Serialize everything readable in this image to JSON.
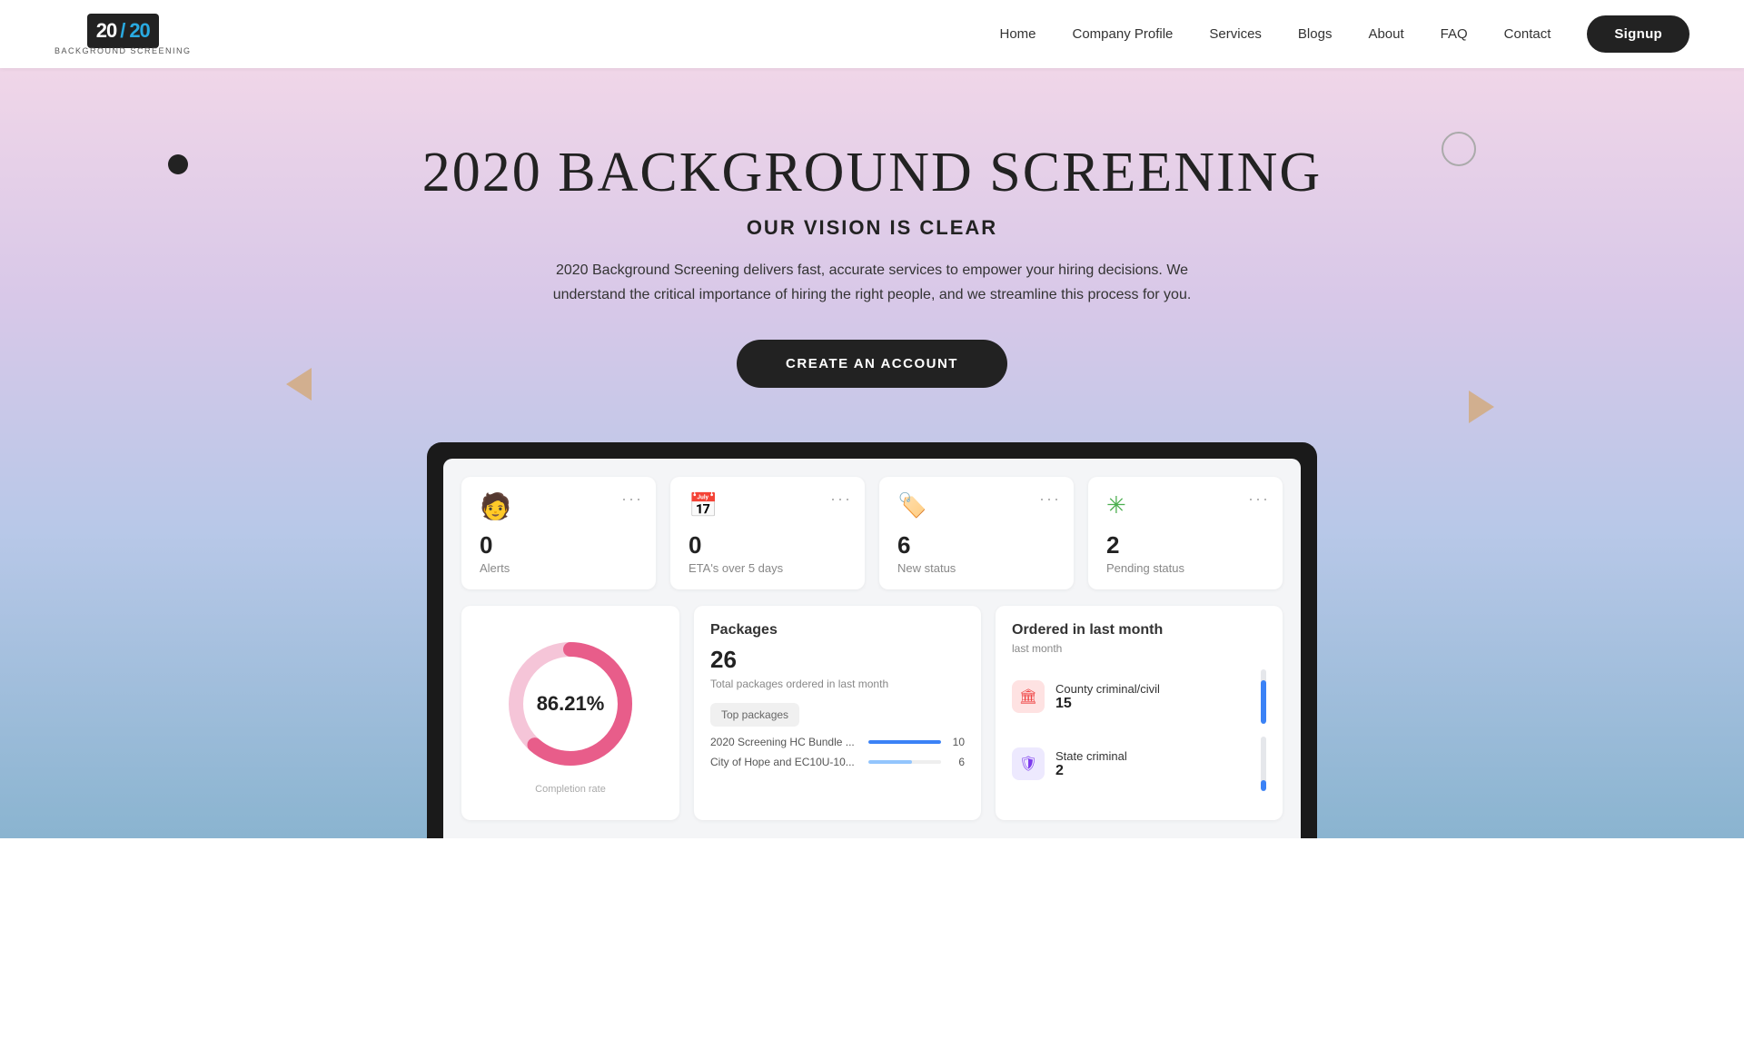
{
  "nav": {
    "logo_text_left": "20",
    "logo_slash": "/",
    "logo_text_right": "20",
    "logo_sub": "BACKGROUND SCREENING",
    "links": [
      {
        "label": "Home",
        "key": "home"
      },
      {
        "label": "Company Profile",
        "key": "company-profile"
      },
      {
        "label": "Services",
        "key": "services"
      },
      {
        "label": "Blogs",
        "key": "blogs"
      },
      {
        "label": "About",
        "key": "about"
      },
      {
        "label": "FAQ",
        "key": "faq"
      },
      {
        "label": "Contact",
        "key": "contact"
      }
    ],
    "signup_label": "Signup"
  },
  "hero": {
    "title": "2020 BACKGROUND SCREENING",
    "subtitle": "OUR VISION IS CLEAR",
    "description": "2020 Background Screening delivers fast, accurate services to empower your hiring decisions. We understand the critical importance of hiring the right people, and we streamline this process for you.",
    "cta_label": "CREATE AN ACCOUNT"
  },
  "dashboard": {
    "stat_cards": [
      {
        "icon": "person-icon",
        "icon_char": "👤",
        "number": "0",
        "label": "Alerts"
      },
      {
        "icon": "calendar-icon",
        "icon_char": "📅",
        "number": "0",
        "label": "ETA's over 5 days"
      },
      {
        "icon": "tag-icon",
        "icon_char": "🏷️",
        "number": "6",
        "label": "New status"
      },
      {
        "icon": "spinner-icon",
        "icon_char": "✳",
        "number": "2",
        "label": "Pending status"
      }
    ],
    "donut": {
      "percentage": "86.21%",
      "label": "Completion rate",
      "value": 86.21,
      "color_fill": "#e85d8a",
      "color_bg": "#f5c5d8"
    },
    "packages": {
      "title": "Packages",
      "count": "26",
      "sub_label": "Total packages ordered in last month",
      "top_label": "Top packages",
      "items": [
        {
          "name": "2020 Screening HC Bundle ...",
          "value": 10,
          "max": 10,
          "bar_class": "pkg-bar-blue"
        },
        {
          "name": "City of Hope and EC10U-10...",
          "value": 6,
          "max": 10,
          "bar_class": "pkg-bar-light"
        }
      ]
    },
    "orders": {
      "title": "Ordered in last month",
      "period": "last month",
      "items": [
        {
          "icon_char": "🏛",
          "icon_class": "order-icon-red",
          "name": "County criminal/civil",
          "count": "15",
          "bar_height": "80"
        },
        {
          "icon_char": "🛡",
          "icon_class": "order-icon-purple",
          "name": "State criminal",
          "count": "2",
          "bar_height": "20"
        }
      ]
    }
  }
}
